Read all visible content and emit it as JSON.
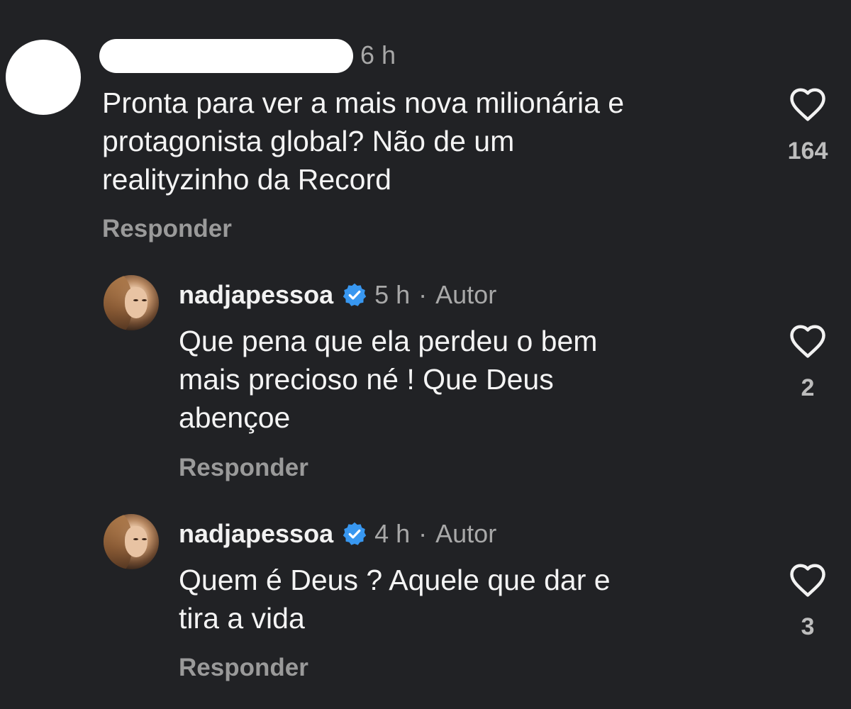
{
  "comments": [
    {
      "time": "6 h",
      "text_lines": [
        "Pronta para ver a mais nova milionária e",
        "protagonista global? Não de um",
        "realityzinho da Record"
      ],
      "reply_label": "Responder",
      "like_count": "164"
    },
    {
      "username": "nadjapessoa",
      "time": "5 h",
      "separator": "·",
      "author_tag": "Autor",
      "text_lines": [
        "Que pena que ela perdeu o bem",
        "mais precioso né ! Que Deus",
        "abençoe"
      ],
      "reply_label": "Responder",
      "like_count": "2"
    },
    {
      "username": "nadjapessoa",
      "time": "4 h",
      "separator": "·",
      "author_tag": "Autor",
      "text_lines": [
        "Quem é Deus ? Aquele que dar e",
        "tira a vida"
      ],
      "reply_label": "Responder",
      "like_count": "3"
    }
  ],
  "icons": {
    "verified": "verified-badge-icon",
    "like": "heart-outline-icon"
  },
  "colors": {
    "background": "#212225",
    "verified_blue": "#3897f0",
    "muted": "#a8a8a8"
  }
}
